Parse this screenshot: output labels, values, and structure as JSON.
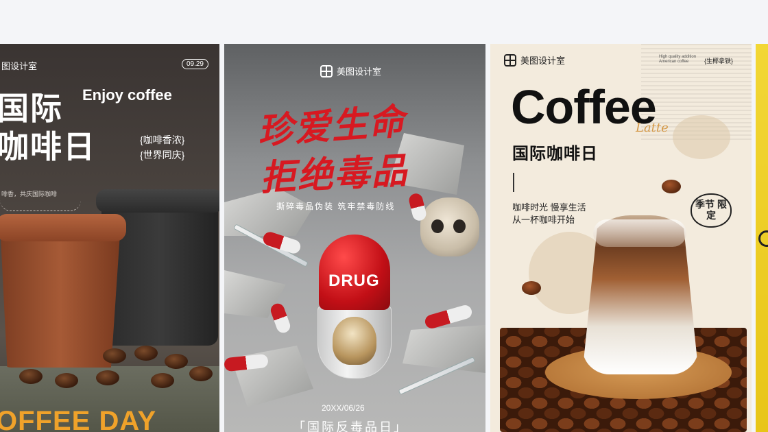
{
  "cards": [
    {
      "brand": "图设计室",
      "date": "09.29",
      "title_line1": "国际",
      "title_line2": "咖啡日",
      "english": "Enjoy coffee",
      "tag1": "{咖啡香浓}",
      "tag2": "{世界同庆}",
      "small": "啡香，共庆国际咖啡",
      "footer": "OFFEE DAY"
    },
    {
      "brand": "美图设计室",
      "headline1": "珍爱生命",
      "headline2": "拒绝毒品",
      "sub": "撕碎毒品伪装  筑牢禁毒防线",
      "pill_label": "DRUG",
      "date": "20XX/06/26",
      "footer": "「国际反毒品日」"
    },
    {
      "brand": "美图设计室",
      "quality": "High quality addition American coffee",
      "tag_right": "{生椰拿铁}",
      "title": "Coffee",
      "script": "Latte",
      "subtitle": "国际咖啡日",
      "line1": "咖啡时光 慢享生活",
      "line2": "从一杯咖啡开始",
      "seal": "季节 限定"
    }
  ]
}
